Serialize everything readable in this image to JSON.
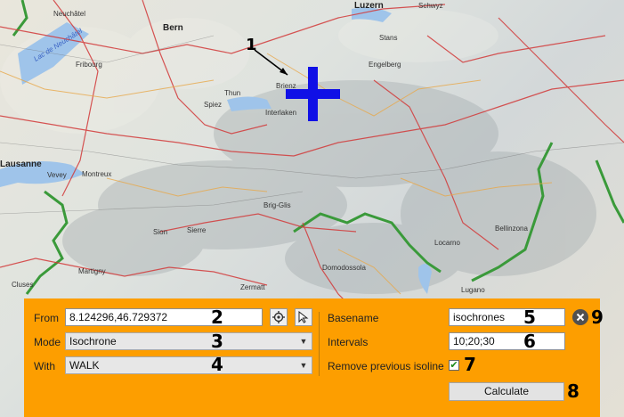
{
  "map": {
    "places": [
      {
        "text": "Neuchâtel",
        "cls": ""
      },
      {
        "text": "Bern",
        "cls": "big"
      },
      {
        "text": "Luzern",
        "cls": "big"
      },
      {
        "text": "Schwyz",
        "cls": ""
      },
      {
        "text": "Fribourg",
        "cls": ""
      },
      {
        "text": "Thun",
        "cls": ""
      },
      {
        "text": "Brienz",
        "cls": ""
      },
      {
        "text": "Interlaken",
        "cls": ""
      },
      {
        "text": "Spiez",
        "cls": ""
      },
      {
        "text": "Lausanne",
        "cls": "big"
      },
      {
        "text": "Vevey",
        "cls": ""
      },
      {
        "text": "Montreux",
        "cls": ""
      },
      {
        "text": "Brig-Glis",
        "cls": ""
      },
      {
        "text": "Sion",
        "cls": ""
      },
      {
        "text": "Sierre",
        "cls": ""
      },
      {
        "text": "Domodossola",
        "cls": ""
      },
      {
        "text": "Locarno",
        "cls": ""
      },
      {
        "text": "Bellinzona",
        "cls": ""
      },
      {
        "text": "Lugano",
        "cls": ""
      },
      {
        "text": "Martigny",
        "cls": ""
      },
      {
        "text": "Cluses",
        "cls": ""
      },
      {
        "text": "Lac de Neuchâtel",
        "cls": "water"
      },
      {
        "text": "Stans",
        "cls": ""
      },
      {
        "text": "Engelberg",
        "cls": ""
      },
      {
        "text": "Zermatt",
        "cls": ""
      }
    ],
    "marker_color": "#1010e6",
    "callout_1": "1"
  },
  "panel": {
    "background": "#fd9e00",
    "from_label": "From",
    "from_value": "8.124296,46.729372",
    "mode_label": "Mode",
    "mode_value": "Isochrone",
    "with_label": "With",
    "with_value": "WALK",
    "basename_label": "Basename",
    "basename_value": "isochrones",
    "intervals_label": "Intervals",
    "intervals_value": "10;20;30",
    "remove_label": "Remove previous isoline",
    "remove_checked": "✔",
    "calculate_label": "Calculate",
    "callouts": {
      "n2": "2",
      "n3": "3",
      "n4": "4",
      "n5": "5",
      "n6": "6",
      "n7": "7",
      "n8": "8",
      "n9": "9"
    }
  }
}
